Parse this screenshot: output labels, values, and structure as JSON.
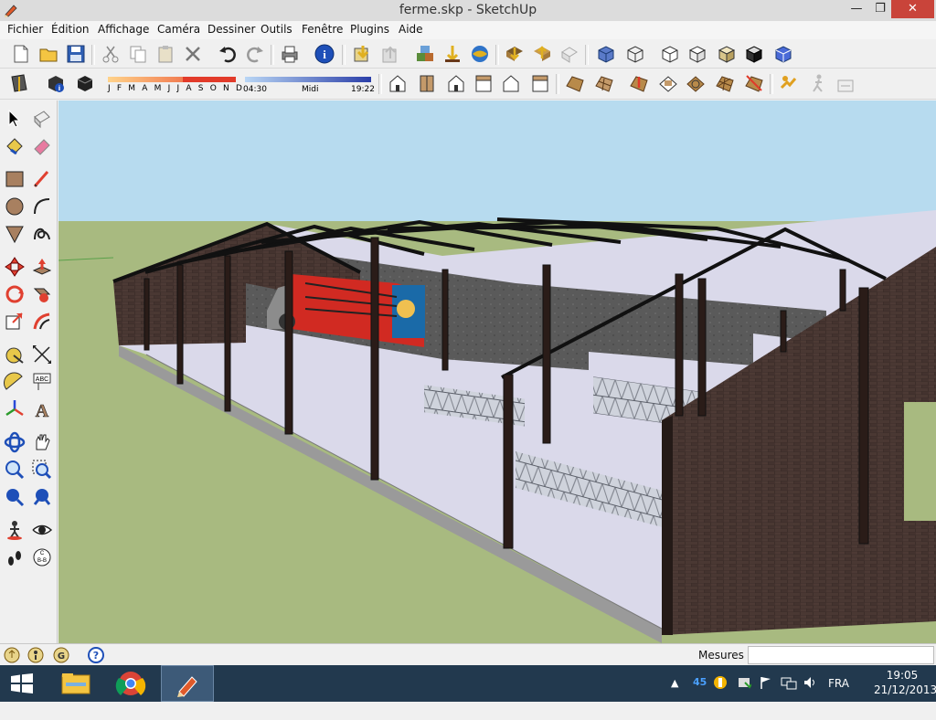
{
  "window": {
    "title": "ferme.skp - SketchUp",
    "min_glyph": "—",
    "max_glyph": "❐",
    "close_glyph": "✕"
  },
  "menu": [
    "Fichier",
    "Édition",
    "Affichage",
    "Caméra",
    "Dessiner",
    "Outils",
    "Fenêtre",
    "Plugins",
    "Aide"
  ],
  "shadow": {
    "months": "J  F  M  A  M  J  J  A  S  O  N  D",
    "time_start": "04:30",
    "time_mid": "Midi",
    "time_end": "19:22"
  },
  "status": {
    "measure_label": "Mesures",
    "measure_value": ""
  },
  "taskbar": {
    "lang": "FRA",
    "time": "19:05",
    "date": "21/12/2013",
    "tray_num": "45"
  },
  "colors": {
    "sky": "#b7dbef",
    "grass": "#a8ba80",
    "brick": "#3d2e2a",
    "floor": "#dad9ea",
    "steel": "#111111",
    "red_truck": "#d12a22"
  },
  "icons": {
    "toolbar1": [
      "new-icon",
      "open-icon",
      "save-icon",
      "cut-icon",
      "copy-icon",
      "paste-icon",
      "erase-icon",
      "undo-icon",
      "redo-icon",
      "print-icon",
      "model-info-icon",
      "get-models-icon",
      "share-model-icon",
      "component-icon",
      "3d-warehouse-icon",
      "get-photo-icon",
      "add-location-icon",
      "toggle-terrain-icon",
      "xray-style-icon",
      "wireframe-style-icon",
      "hidden-line-style-icon",
      "shaded-style-icon",
      "textured-style-icon",
      "monochrome-style-icon",
      "back-edges-style-icon"
    ],
    "toolbar2": [
      "section-plane-icon",
      "display-section-icon",
      "display-section-cut-icon",
      "iso-view-icon",
      "top-view-icon",
      "front-view-icon",
      "right-view-icon",
      "back-view-icon",
      "left-view-icon",
      "sandbox-from-contours-icon",
      "sandbox-from-scratch-icon",
      "smoove-icon",
      "stamp-icon",
      "drape-icon",
      "add-detail-icon",
      "flip-edge-icon",
      "position-camera-icon",
      "walk-icon",
      "look-around-icon"
    ],
    "left": [
      "select-icon",
      "make-component-icon",
      "paint-bucket-icon",
      "eraser-icon",
      "rectangle-icon",
      "line-icon",
      "circle-icon",
      "arc-icon",
      "polygon-icon",
      "freehand-icon",
      "move-icon",
      "push-pull-icon",
      "rotate-icon",
      "follow-me-icon",
      "scale-icon",
      "offset-icon",
      "tape-measure-icon",
      "dimension-icon",
      "protractor-icon",
      "text-icon",
      "axes-icon",
      "3d-text-icon",
      "orbit-icon",
      "pan-icon",
      "zoom-icon",
      "zoom-window-icon",
      "zoom-extents-icon",
      "previous-view-icon",
      "position-camera-icon",
      "look-around-icon",
      "walk-icon",
      "section-plane-icon"
    ],
    "status": [
      "geo-location-icon",
      "credits-icon",
      "user-icon",
      "help-icon"
    ]
  }
}
